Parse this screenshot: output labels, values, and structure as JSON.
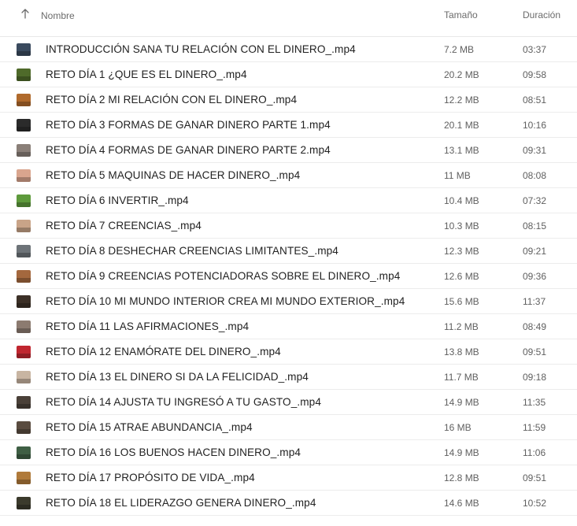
{
  "header": {
    "name_label": "Nombre",
    "size_label": "Tamaño",
    "duration_label": "Duración",
    "sort_icon": "arrow-up-icon"
  },
  "files": [
    {
      "name": "INTRODUCCIÓN SANA TU RELACIÓN CON EL DINERO_.mp4",
      "size": "7.2 MB",
      "duration": "03:37",
      "thumb_color": "#3a4a5e"
    },
    {
      "name": "RETO DÍA 1 ¿QUE ES EL DINERO_.mp4",
      "size": "20.2 MB",
      "duration": "09:58",
      "thumb_color": "#4f6a2a"
    },
    {
      "name": "RETO DÍA 2 MI RELACIÓN CON EL DINERO_.mp4",
      "size": "12.2 MB",
      "duration": "08:51",
      "thumb_color": "#b06a2c"
    },
    {
      "name": "RETO DÍA 3 FORMAS DE GANAR DINERO PARTE 1.mp4",
      "size": "20.1 MB",
      "duration": "10:16",
      "thumb_color": "#2b2b2b"
    },
    {
      "name": "RETO DÍA 4 FORMAS DE GANAR DINERO PARTE 2.mp4",
      "size": "13.1 MB",
      "duration": "09:31",
      "thumb_color": "#8a7f78"
    },
    {
      "name": "RETO DÍA 5 MAQUINAS DE HACER DINERO_.mp4",
      "size": "11 MB",
      "duration": "08:08",
      "thumb_color": "#d9a58e"
    },
    {
      "name": "RETO DÍA 6 INVERTIR_.mp4",
      "size": "10.4 MB",
      "duration": "07:32",
      "thumb_color": "#5e9a3c"
    },
    {
      "name": "RETO DÍA 7 CREENCIAS_.mp4",
      "size": "10.3 MB",
      "duration": "08:15",
      "thumb_color": "#c9a488"
    },
    {
      "name": "RETO DÍA 8 DESHECHAR CREENCIAS LIMITANTES_.mp4",
      "size": "12.3 MB",
      "duration": "09:21",
      "thumb_color": "#6d7378"
    },
    {
      "name": "RETO DÍA 9 CREENCIAS POTENCIADORAS SOBRE EL DINERO_.mp4",
      "size": "12.6 MB",
      "duration": "09:36",
      "thumb_color": "#a4683e"
    },
    {
      "name": "RETO DÍA 10 MI MUNDO INTERIOR CREA MI MUNDO EXTERIOR_.mp4",
      "size": "15.6 MB",
      "duration": "11:37",
      "thumb_color": "#3c3027"
    },
    {
      "name": "RETO DÍA 11 LAS AFIRMACIONES_.mp4",
      "size": "11.2 MB",
      "duration": "08:49",
      "thumb_color": "#8c7b70"
    },
    {
      "name": "RETO DÍA 12 ENAMÓRATE DEL DINERO_.mp4",
      "size": "13.8 MB",
      "duration": "09:51",
      "thumb_color": "#c0262f"
    },
    {
      "name": "RETO DÍA 13 EL DINERO SI DA LA FELICIDAD_.mp4",
      "size": "11.7 MB",
      "duration": "09:18",
      "thumb_color": "#c8b5a2"
    },
    {
      "name": "RETO DÍA 14 AJUSTA TU INGRESÓ A TU GASTO_.mp4",
      "size": "14.9 MB",
      "duration": "11:35",
      "thumb_color": "#4a4038"
    },
    {
      "name": "RETO DÍA 15 ATRAE ABUNDANCIA_.mp4",
      "size": "16 MB",
      "duration": "11:59",
      "thumb_color": "#5a4c40"
    },
    {
      "name": "RETO DÍA 16 LOS BUENOS HACEN DINERO_.mp4",
      "size": "14.9 MB",
      "duration": "11:06",
      "thumb_color": "#3f5f44"
    },
    {
      "name": "RETO DÍA 17 PROPÓSITO DE VIDA_.mp4",
      "size": "12.8 MB",
      "duration": "09:51",
      "thumb_color": "#b07a3a"
    },
    {
      "name": "RETO DÍA 18 EL LIDERAZGO GENERA DINERO_.mp4",
      "size": "14.6 MB",
      "duration": "10:52",
      "thumb_color": "#3b3a2c"
    }
  ]
}
